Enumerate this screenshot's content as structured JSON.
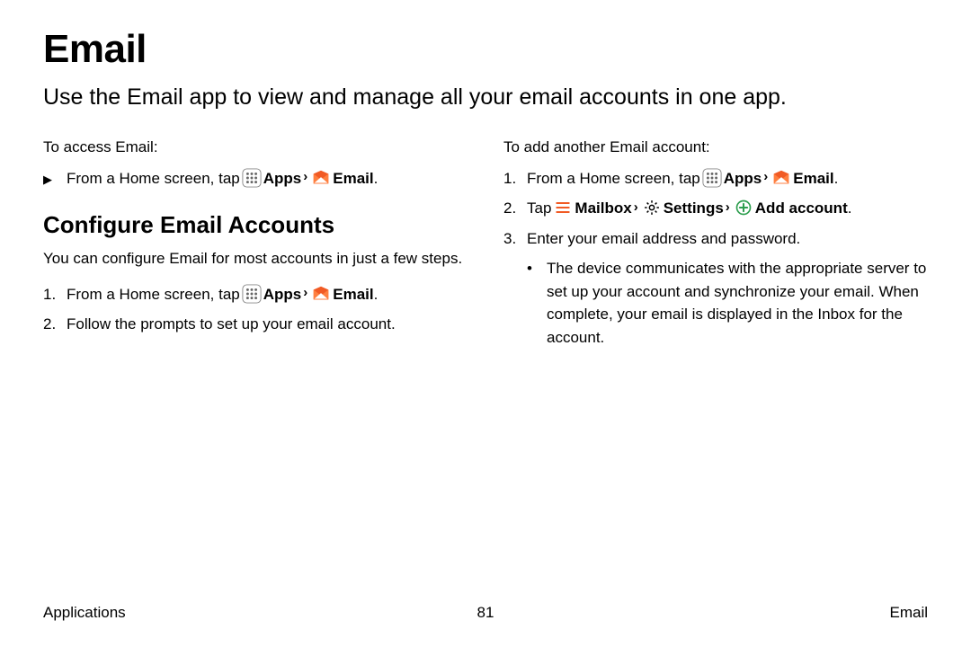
{
  "title": "Email",
  "intro": "Use the Email app to view and manage all your email accounts in one app.",
  "left": {
    "access_label": "To access Email:",
    "access_step_prefix": "From a Home screen, tap ",
    "apps_label": "Apps",
    "email_label": "Email",
    "subheading": "Configure Email Accounts",
    "config_intro": "You can configure Email for most accounts in just a few steps.",
    "step1_num": "1.",
    "step1_prefix": "From a Home screen, tap ",
    "step2_num": "2.",
    "step2_text": "Follow the prompts to set up your email account."
  },
  "right": {
    "add_label": "To add another Email account:",
    "step1_num": "1.",
    "step1_prefix": "From a Home screen, tap ",
    "apps_label": "Apps",
    "email_label": "Email",
    "step2_num": "2.",
    "step2_prefix": "Tap ",
    "mailbox_label": "Mailbox",
    "settings_label": "Settings",
    "add_account_label": "Add account",
    "step3_num": "3.",
    "step3_text": "Enter your email address and password.",
    "bullet_text": "The device communicates with the appropriate server to set up your account and synchronize your email. When complete, your email is displayed in the Inbox for the account."
  },
  "footer": {
    "left": "Applications",
    "center": "81",
    "right": "Email"
  }
}
